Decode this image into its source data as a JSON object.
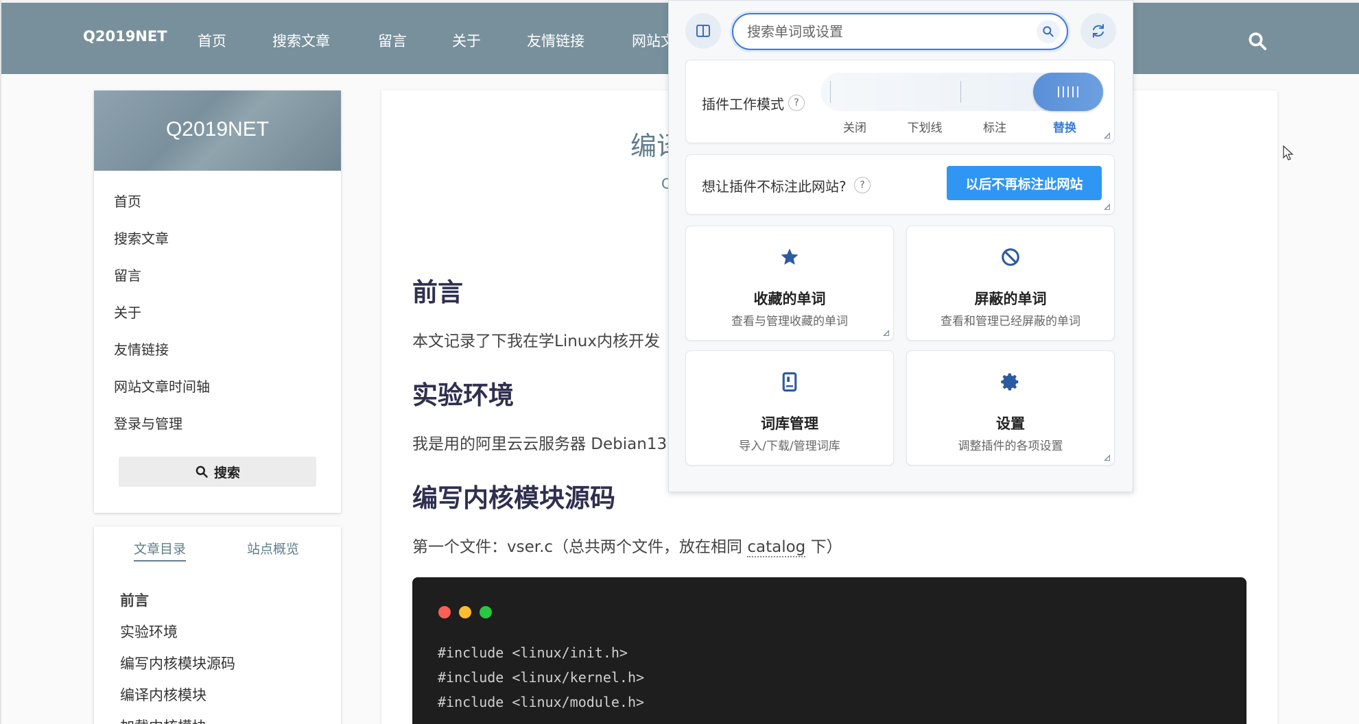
{
  "navbar": {
    "brand": "Q2019NET",
    "items": [
      {
        "label": "首页"
      },
      {
        "label": "搜索文章"
      },
      {
        "label": "留言"
      },
      {
        "label": "关于"
      },
      {
        "label": "友情链接"
      },
      {
        "label": "网站文"
      }
    ],
    "search_icon": "search-icon"
  },
  "sidebar": {
    "title": "Q2019NET",
    "links": [
      {
        "label": "首页"
      },
      {
        "label": "搜索文章"
      },
      {
        "label": "留言"
      },
      {
        "label": "关于"
      },
      {
        "label": "友情链接"
      },
      {
        "label": "网站文章时间轴"
      },
      {
        "label": "登录与管理"
      }
    ],
    "search_button": "搜索"
  },
  "toc": {
    "tabs": [
      {
        "label": "文章目录",
        "active": true
      },
      {
        "label": "站点概览",
        "active": false
      }
    ],
    "items": [
      {
        "label": "前言",
        "active": true
      },
      {
        "label": "实验环境"
      },
      {
        "label": "编写内核模块源码"
      },
      {
        "label": "编译内核模块"
      },
      {
        "label": "加载内核模块"
      }
    ]
  },
  "article": {
    "title_peek": "编译",
    "subtitle_peek": "C",
    "sections": [
      {
        "heading": "前言",
        "text": "本文记录了下我在学Linux内核开发"
      },
      {
        "heading": "实验环境",
        "text": "我是用的阿里云云服务器 Debian13"
      },
      {
        "heading": "编写内核模块源码",
        "text_before": "第一个文件：vser.c（总共两个文件，放在相同 ",
        "text_underlined": "catalog",
        "text_after": " 下）"
      }
    ],
    "code_lines": [
      "#include <linux/init.h>",
      "#include <linux/kernel.h>",
      "#include <linux/module.h>"
    ],
    "code_dots": [
      "#ff5f57",
      "#febc2e",
      "#28c840"
    ]
  },
  "plugin": {
    "search": {
      "placeholder": "搜索单词或设置",
      "value": ""
    },
    "mode": {
      "label": "插件工作模式",
      "help": "?",
      "options": [
        {
          "label": "关闭"
        },
        {
          "label": "下划线"
        },
        {
          "label": "标注"
        },
        {
          "label": "替换",
          "active": true
        }
      ]
    },
    "site": {
      "label": "想让插件不标注此网站?",
      "help": "?",
      "button": "以后不再标注此网站"
    },
    "features": [
      {
        "title": "收藏的单词",
        "desc": "查看与管理收藏的单词",
        "icon": "star-icon"
      },
      {
        "title": "屏蔽的单词",
        "desc": "查看和管理已经屏蔽的单词",
        "icon": "block-icon"
      },
      {
        "title": "词库管理",
        "desc": "导入/下载/管理词库",
        "icon": "book-icon"
      },
      {
        "title": "设置",
        "desc": "调整插件的各项设置",
        "icon": "gear-icon"
      }
    ],
    "accent": "#2f96f3"
  }
}
